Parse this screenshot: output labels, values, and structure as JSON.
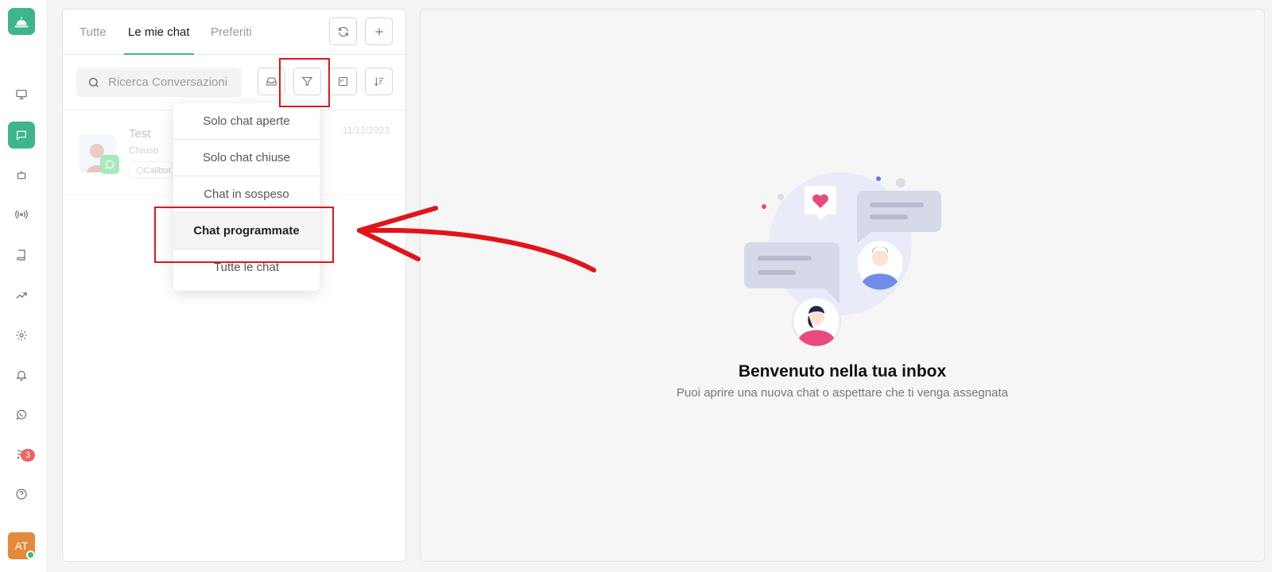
{
  "sidebar": {
    "logo_icon": "concierge-bell-icon",
    "items": [
      {
        "name": "sidebar-item-dashboard",
        "icon": "monitor-icon"
      },
      {
        "name": "sidebar-item-chat",
        "icon": "chat-bubble-icon",
        "active": true
      },
      {
        "name": "sidebar-item-bot",
        "icon": "robot-icon"
      },
      {
        "name": "sidebar-item-broadcast",
        "icon": "broadcast-icon"
      },
      {
        "name": "sidebar-item-knowledge",
        "icon": "book-icon"
      },
      {
        "name": "sidebar-item-analytics",
        "icon": "trending-up-icon"
      },
      {
        "name": "sidebar-item-settings",
        "icon": "gear-icon"
      },
      {
        "name": "sidebar-item-notifications",
        "icon": "bell-icon"
      },
      {
        "name": "sidebar-item-whatsapp",
        "icon": "whatsapp-icon"
      },
      {
        "name": "sidebar-item-feed",
        "icon": "rss-icon",
        "badge": "3"
      },
      {
        "name": "sidebar-item-help",
        "icon": "help-circle-icon"
      }
    ],
    "notification_badge": "3",
    "user_initials": "AT"
  },
  "list_panel": {
    "tabs": [
      {
        "label": "Tutte",
        "active": false
      },
      {
        "label": "Le mie chat",
        "active": true
      },
      {
        "label": "Preferiti",
        "active": false
      }
    ],
    "header_buttons": [
      "refresh-icon",
      "plus-icon"
    ],
    "search": {
      "placeholder": "Ricerca Conversazioni",
      "value": ""
    },
    "toolbar_buttons": [
      "inbox-icon",
      "filter-icon",
      "kanban-icon",
      "sort-icon"
    ],
    "conversations": [
      {
        "name": "Test",
        "status": "Chiuso",
        "tag": "Callbot",
        "date": "11/12/2023",
        "channel_icon": "whatsapp-icon"
      }
    ]
  },
  "filter_dropdown": {
    "items": [
      {
        "label": "Solo chat aperte",
        "selected": false
      },
      {
        "label": "Solo chat chiuse",
        "selected": false
      },
      {
        "label": "Chat in sospeso",
        "selected": false
      },
      {
        "label": "Chat programmate",
        "selected": true
      },
      {
        "label": "Tutte le chat",
        "selected": false
      }
    ]
  },
  "main_panel": {
    "title": "Benvenuto nella tua inbox",
    "subtitle": "Puoi aprire una nuova chat o aspettare che ti venga assegnata"
  },
  "colors": {
    "accent": "#3eb58c",
    "annotation": "#e2141b",
    "badge": "#f06363",
    "avatar": "#e58a3a"
  }
}
